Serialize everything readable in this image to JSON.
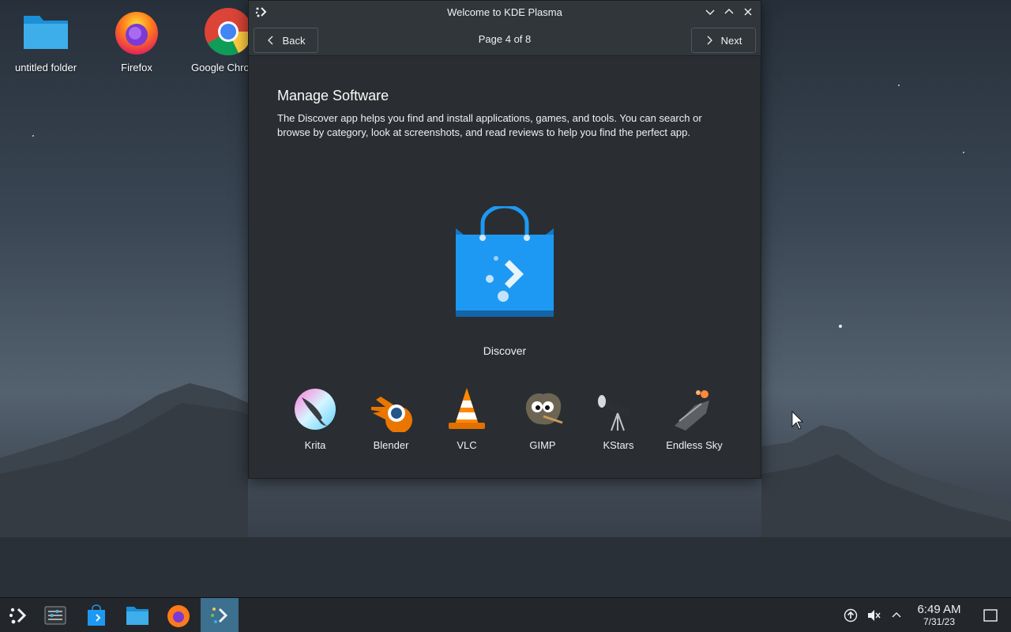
{
  "desktop": {
    "icons": [
      {
        "label": "untitled folder",
        "icon": "folder-icon"
      },
      {
        "label": "Firefox",
        "icon": "firefox-icon"
      },
      {
        "label": "Google Chrome",
        "icon": "chrome-icon"
      }
    ]
  },
  "window": {
    "title": "Welcome to KDE Plasma",
    "back_label": "Back",
    "next_label": "Next",
    "page_indicator": "Page 4 of 8",
    "heading": "Manage Software",
    "description": "The Discover app helps you find and install applications, games, and tools. You can search or browse by category, look at screenshots, and read reviews to help you find the perfect app.",
    "hero_label": "Discover",
    "apps": [
      {
        "label": "Krita",
        "icon": "krita-icon"
      },
      {
        "label": "Blender",
        "icon": "blender-icon"
      },
      {
        "label": "VLC",
        "icon": "vlc-icon"
      },
      {
        "label": "GIMP",
        "icon": "gimp-icon"
      },
      {
        "label": "KStars",
        "icon": "kstars-icon"
      },
      {
        "label": "Endless Sky",
        "icon": "endless-sky-icon"
      }
    ]
  },
  "taskbar": {
    "items": [
      "application-launcher-icon",
      "system-settings-icon",
      "discover-icon",
      "dolphin-files-icon",
      "firefox-icon",
      "welcome-center-icon"
    ],
    "time": "6:49 AM",
    "date": "7/31/23"
  },
  "colors": {
    "accent": "#3d6f8f",
    "window_bg": "#2a2e32",
    "titlebar_bg": "#31363b",
    "discover_blue": "#1d99f3"
  }
}
